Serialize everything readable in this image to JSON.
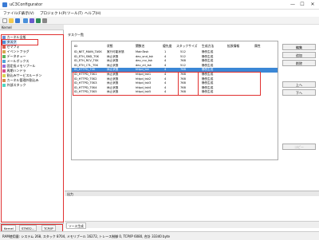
{
  "window": {
    "title": "uC3Configurator",
    "minimize": "—",
    "maximize": "☐",
    "close": "✕"
  },
  "menu": [
    "ファイル(F)",
    "表示(V)",
    "プロジェクト(P)",
    "ツール(T)",
    "ヘルプ(H)"
  ],
  "left_panel": {
    "header": "Kernel",
    "tree": [
      "カーネル全般",
      "タスク",
      "セマフォ",
      "イベントフラグ",
      "データキュー",
      "メールボックス",
      "固定長メモリプール",
      "周期ハンドラ",
      "割込みサービスルーチン",
      "カーネル管理外割込み",
      "外部スタック"
    ]
  },
  "bottom_tabs": [
    "Kernel",
    "STM32...",
    "TCP/IP"
  ],
  "main": {
    "section_label": "タスク一覧",
    "columns": [
      "ID",
      "状態",
      "関数名",
      "優先度",
      "スタックサイズ",
      "生成方法",
      "拡張情報",
      "属性"
    ],
    "rows": [
      [
        "ID_NET_MAIN_TASK",
        "実行可能状態",
        "MainTask",
        "1",
        "512",
        "静的生成"
      ],
      [
        "ID_ETH_SND_TSK",
        "休止状態",
        "dev_snd_tsk",
        "4",
        "512",
        "静的生成"
      ],
      [
        "ID_ETH_RCV_TSK",
        "休止状態",
        "dev_rcv_tsk",
        "4",
        "768",
        "静的生成"
      ],
      [
        "ID_ETH_CTL_TSK",
        "休止状態",
        "dev_ctl_tsk",
        "4",
        "512",
        "静的生成"
      ],
      [
        "ID_HTTPD_TSK",
        "休止状態",
        "httpd_tsk",
        "4",
        "768",
        "静的生成"
      ],
      [
        "ID_HTTPD_TSK1",
        "休止状態",
        "httpd_tsk1",
        "4",
        "768",
        "静的生成"
      ],
      [
        "ID_HTTPD_TSK2",
        "休止状態",
        "httpd_tsk2",
        "4",
        "768",
        "静的生成"
      ],
      [
        "ID_HTTPD_TSK3",
        "休止状態",
        "httpd_tsk3",
        "4",
        "768",
        "静的生成"
      ],
      [
        "ID_HTTPD_TSK4",
        "休止状態",
        "httpd_tsk4",
        "4",
        "768",
        "静的生成"
      ],
      [
        "ID_HTTPD_TSK5",
        "休止状態",
        "httpd_tsk5",
        "4",
        "768",
        "静的生成"
      ]
    ],
    "selected_row": 4,
    "buttons": {
      "edit": "編集",
      "add": "追加",
      "delete": "削除",
      "up": "上へ",
      "down": "下へ",
      "copy": "コピー"
    }
  },
  "output": {
    "header": "出力",
    "tab": "ソース生成"
  },
  "status": "RAM使用量: システム 268, スタック 8704, メモリプール 16272, トレース制御 0, TCP/IP 6080, 合計 33340 byte",
  "colors": {
    "highlight": "#e03030",
    "selection": "#3b87d6",
    "accent": "#2f6fc6"
  }
}
